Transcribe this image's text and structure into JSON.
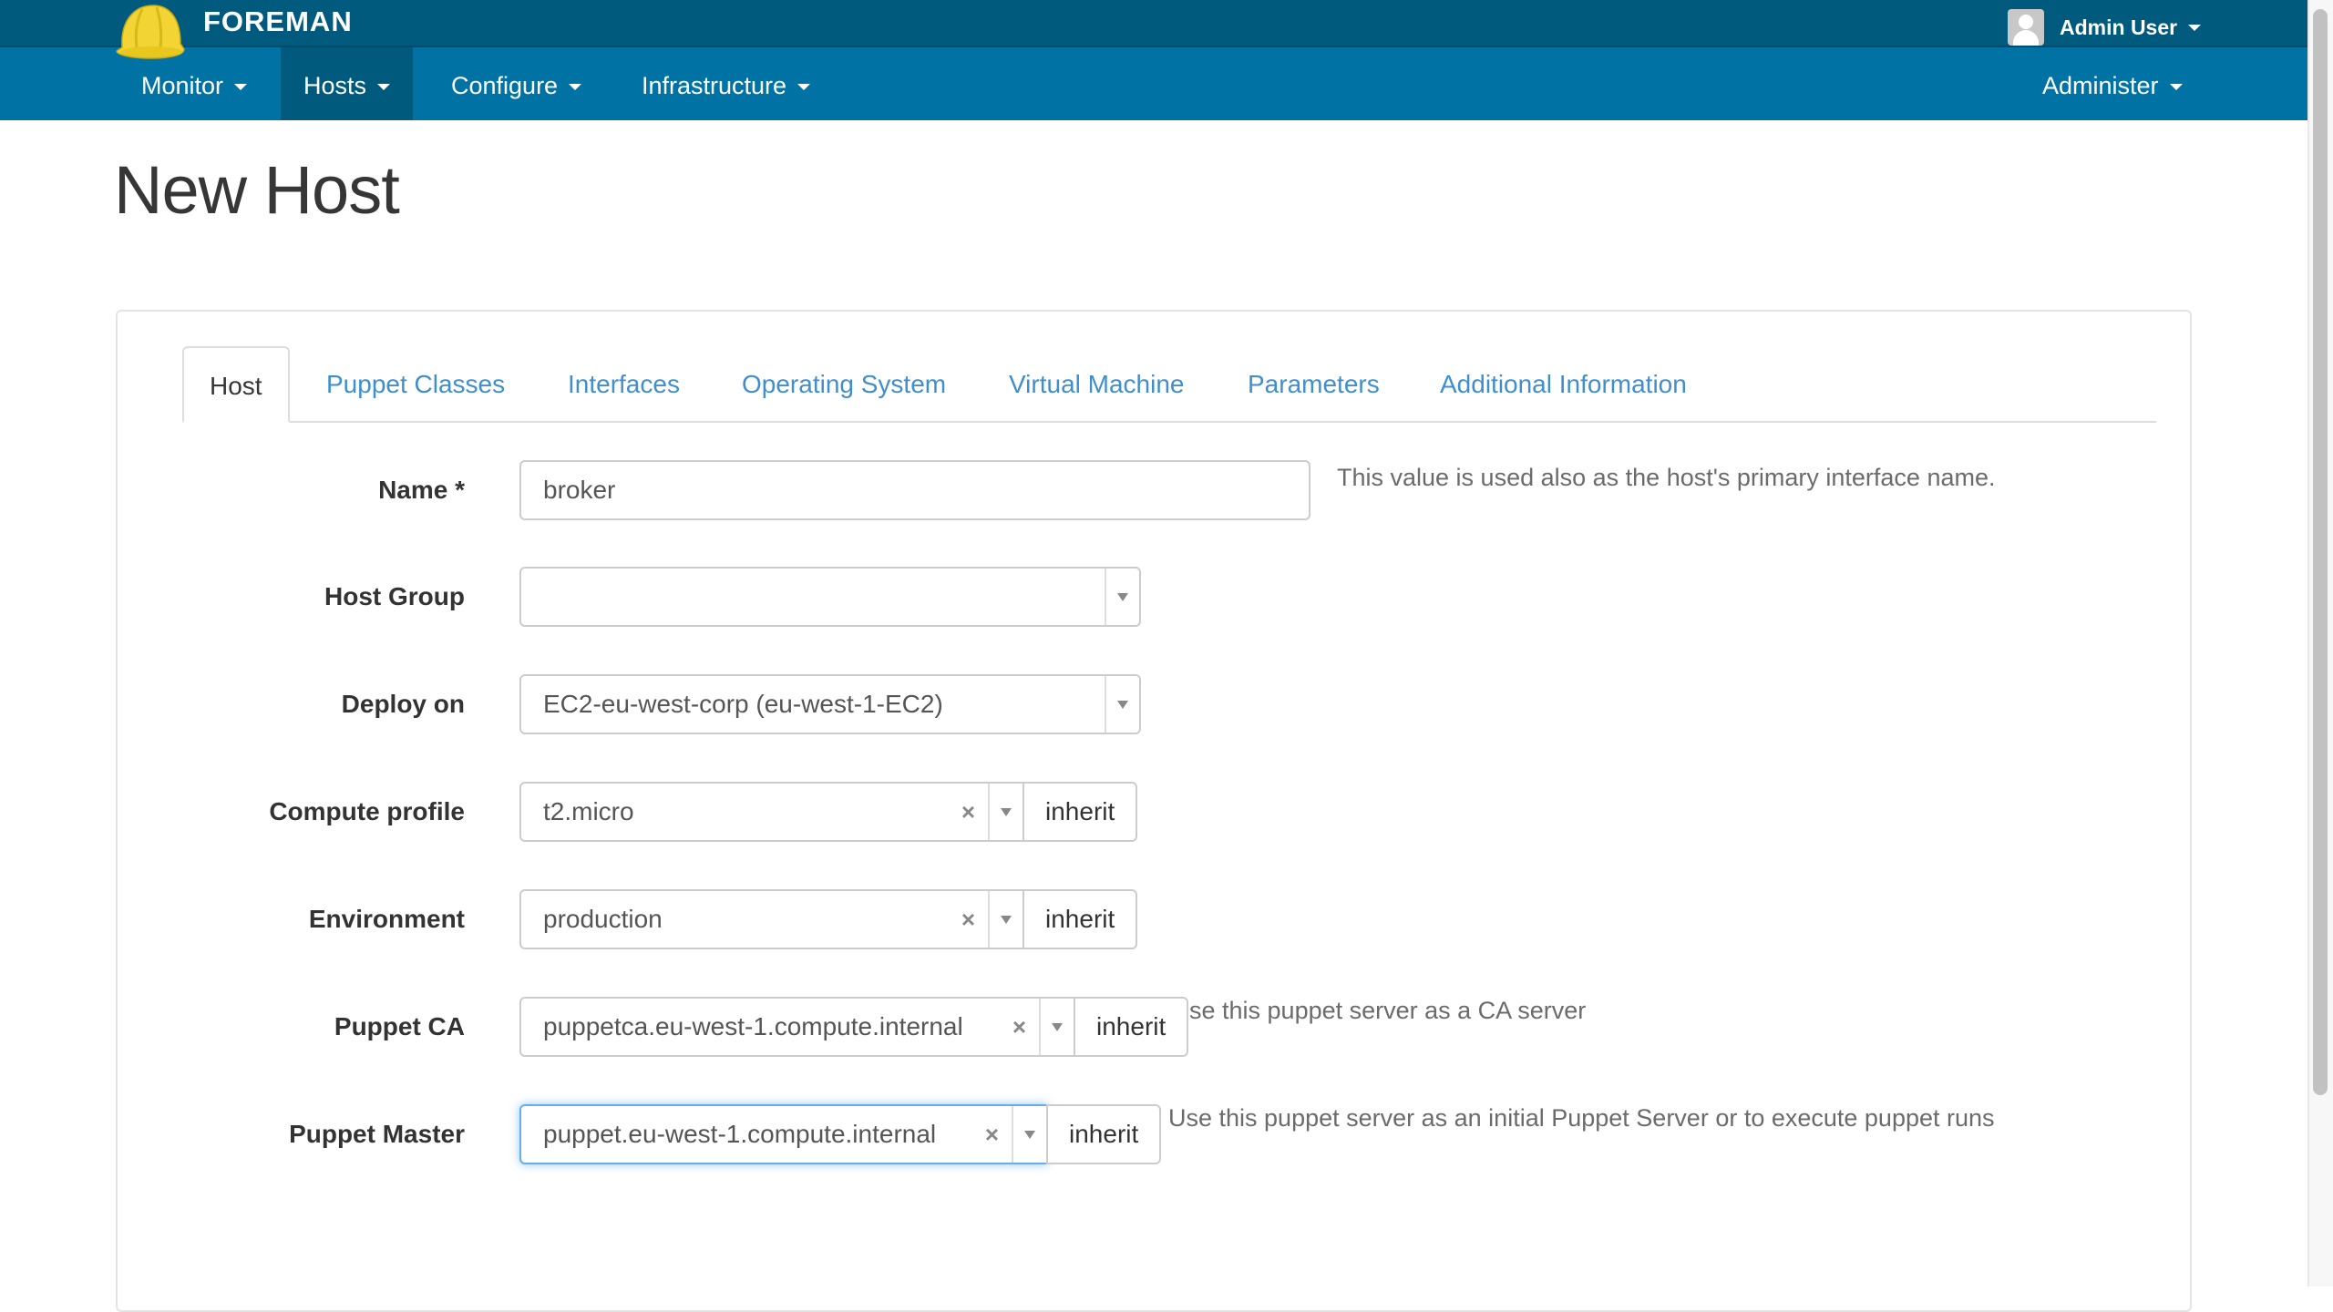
{
  "header": {
    "brand": "FOREMAN",
    "logo_icon": "hard-hat-icon",
    "user_name": "Admin User",
    "colors": {
      "topbar": "#005a7d",
      "navbar": "#0073a4",
      "active_nav": "#005a7d",
      "link": "#3f8fcf",
      "logo": "#f2d434"
    }
  },
  "nav": {
    "items": [
      {
        "label": "Monitor",
        "active": false
      },
      {
        "label": "Hosts",
        "active": true
      },
      {
        "label": "Configure",
        "active": false
      },
      {
        "label": "Infrastructure",
        "active": false
      }
    ],
    "right_item": {
      "label": "Administer"
    }
  },
  "page": {
    "title": "New Host"
  },
  "tabs": [
    {
      "label": "Host",
      "active": true
    },
    {
      "label": "Puppet Classes",
      "active": false
    },
    {
      "label": "Interfaces",
      "active": false
    },
    {
      "label": "Operating System",
      "active": false
    },
    {
      "label": "Virtual Machine",
      "active": false
    },
    {
      "label": "Parameters",
      "active": false
    },
    {
      "label": "Additional Information",
      "active": false
    }
  ],
  "form": {
    "name": {
      "label": "Name *",
      "value": "broker",
      "help": "This value is used also as the host's primary interface name."
    },
    "host_group": {
      "label": "Host Group",
      "value": ""
    },
    "deploy_on": {
      "label": "Deploy on",
      "value": "EC2-eu-west-corp (eu-west-1-EC2)"
    },
    "compute_profile": {
      "label": "Compute profile",
      "value": "t2.micro",
      "inherit_label": "inherit"
    },
    "environment": {
      "label": "Environment",
      "value": "production",
      "inherit_label": "inherit"
    },
    "puppet_ca": {
      "label": "Puppet CA",
      "value": "puppetca.eu-west-1.compute.internal",
      "inherit_label": "inherit",
      "help": "se this puppet server as a CA server"
    },
    "puppet_master": {
      "label": "Puppet Master",
      "value": "puppet.eu-west-1.compute.internal",
      "inherit_label": "inherit",
      "help": "Use this puppet server as an initial Puppet Server or to execute puppet runs",
      "focused": true
    },
    "clear_icon": "×"
  }
}
